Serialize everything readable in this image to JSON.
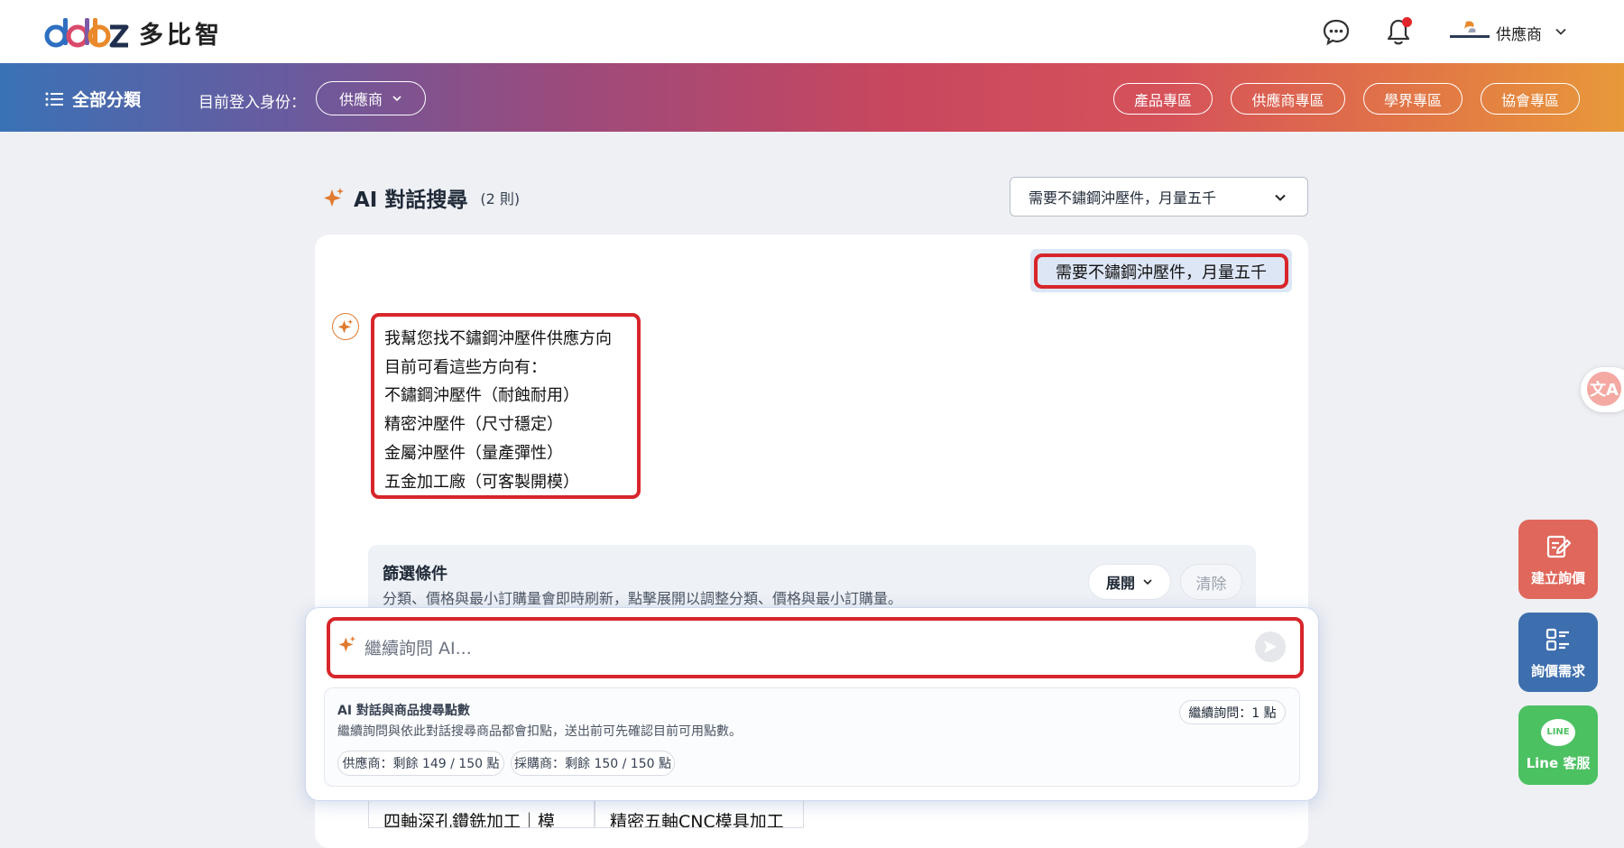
{
  "header": {
    "brand_name": "多比智",
    "user_role": "供應商",
    "colors": {
      "logo_blue": "#2e6fc0",
      "logo_orange": "#e9892b",
      "notification_dot": "#e0262a"
    }
  },
  "nav": {
    "all_categories": "全部分類",
    "identity_label": "目前登入身份：",
    "identity_value": "供應商",
    "zones": [
      "產品專區",
      "供應商專區",
      "學界專區",
      "協會專區"
    ]
  },
  "page": {
    "title": "AI 對話搜尋",
    "count": "(2 則)",
    "conversation_select": "需要不鏽鋼沖壓件，月量五千"
  },
  "chat": {
    "user_message": "需要不鏽鋼沖壓件，月量五千",
    "ai_lines": [
      "我幫您找不鏽鋼沖壓件供應方向",
      "目前可看這些方向有：",
      "不鏽鋼沖壓件（耐蝕耐用）",
      "精密沖壓件（尺寸穩定）",
      "金屬沖壓件（量產彈性）",
      "五金加工廠（可客製開模）"
    ]
  },
  "filter": {
    "title": "篩選條件",
    "description": "分類、價格與最小訂購量會即時刷新，點擊展開以調整分類、價格與最小訂購量。",
    "expand_label": "展開",
    "clear_label": "清除"
  },
  "composer": {
    "placeholder": "繼續詢問 AI...",
    "value": ""
  },
  "points": {
    "title": "AI 對話與商品搜尋點數",
    "description": "繼續詢問與依此對話搜尋商品都會扣點，送出前可先確認目前可用點數。",
    "cost_badge": "繼續詢問：1 點",
    "balances": [
      "供應商：剩餘 149 / 150 點",
      "採購商：剩餘 150 / 150 點"
    ]
  },
  "results_peek": [
    "四軸深孔鑽銑加工｜模",
    "精密五軸CNC模具加工"
  ],
  "floating": {
    "quote_label": "建立詢價",
    "need_label": "詢價需求",
    "line_label": "Line 客服",
    "line_glyph": "LINE",
    "translate_glyph": "文A",
    "colors": {
      "quote": "#e0675b",
      "need": "#3d6eae",
      "line": "#4cc162"
    }
  },
  "accent_color": "#e07a2f",
  "highlight_color": "#d7262b"
}
